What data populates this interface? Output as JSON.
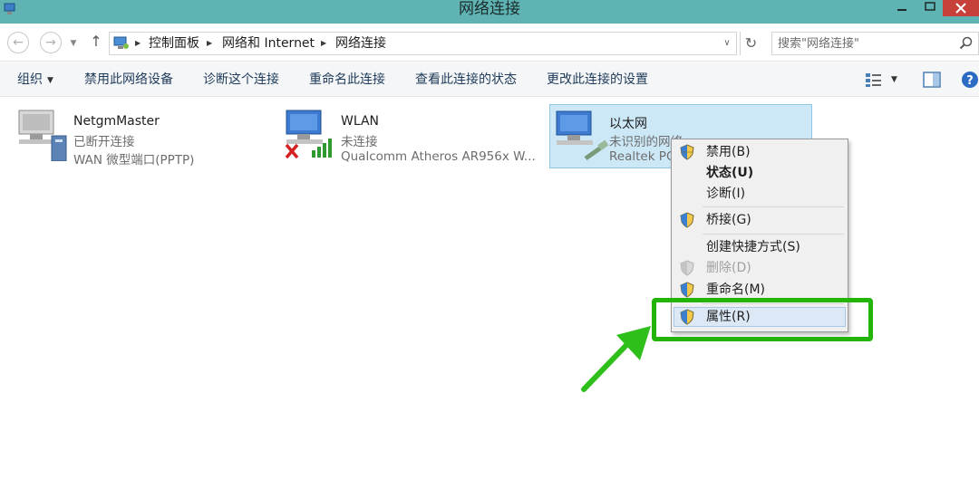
{
  "window": {
    "title": "网络连接"
  },
  "address": {
    "crumbs": [
      "控制面板",
      "网络和 Internet",
      "网络连接"
    ]
  },
  "search": {
    "placeholder": "搜索\"网络连接\""
  },
  "toolbar": {
    "organize": "组织",
    "commands": [
      "禁用此网络设备",
      "诊断这个连接",
      "重命名此连接",
      "查看此连接的状态",
      "更改此连接的设置"
    ]
  },
  "connections": [
    {
      "name": "NetgmMaster",
      "status": "已断开连接",
      "device": "WAN 微型端口(PPTP)"
    },
    {
      "name": "WLAN",
      "status": "未连接",
      "device": "Qualcomm Atheros AR956x W..."
    },
    {
      "name": "以太网",
      "status": "未识别的网络",
      "device": "Realtek PC"
    }
  ],
  "context_menu": {
    "items": [
      {
        "label": "禁用(B)",
        "shield": true
      },
      {
        "label": "状态(U)",
        "bold": true
      },
      {
        "label": "诊断(I)"
      },
      {
        "label": "桥接(G)",
        "shield": true
      },
      {
        "label": "创建快捷方式(S)"
      },
      {
        "label": "删除(D)",
        "shield": true,
        "disabled": true
      },
      {
        "label": "重命名(M)",
        "shield": true
      },
      {
        "label": "属性(R)",
        "shield": true,
        "highlighted": true
      }
    ]
  },
  "colors": {
    "titlebar": "#5fb3b3",
    "annotation": "#23b40a",
    "selection": "#cce8f7"
  },
  "icons": {
    "network": "network-computer-icon",
    "shield": "uac-shield-icon",
    "disconnected": "red-x-icon",
    "signal": "wifi-signal-icon"
  }
}
